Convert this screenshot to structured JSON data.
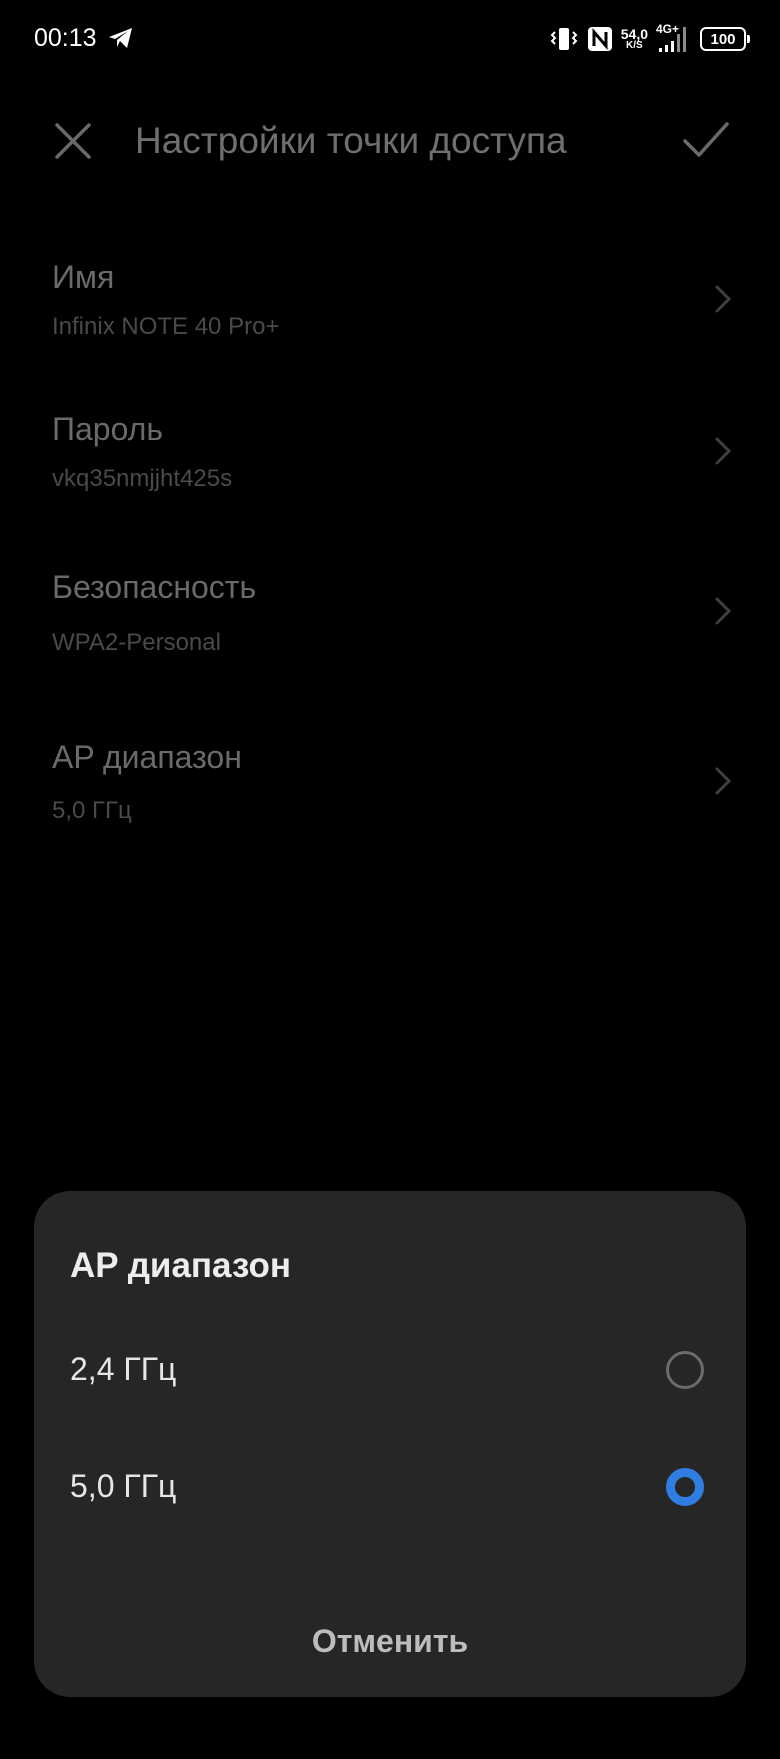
{
  "status_bar": {
    "time": "00:13",
    "net_speed_value": "54,0",
    "net_speed_unit": "K/S",
    "network_type": "4G+",
    "battery": "100",
    "icons": [
      "telegram-icon",
      "vibrate-icon",
      "nfc-icon",
      "signal-icon",
      "battery-icon"
    ]
  },
  "header": {
    "title": "Настройки точки доступа"
  },
  "settings": [
    {
      "title": "Имя",
      "value": "Infinix NOTE 40 Pro+"
    },
    {
      "title": "Пароль",
      "value": "vkq35nmjjht425s"
    },
    {
      "title": "Безопасность",
      "value": "WPA2-Personal"
    },
    {
      "title": "AP диапазон",
      "value": "5,0 ГГц"
    }
  ],
  "sheet": {
    "title": "AP диапазон",
    "options": [
      {
        "label": "2,4 ГГц",
        "selected": false
      },
      {
        "label": "5,0 ГГц",
        "selected": true
      }
    ],
    "cancel_label": "Отменить"
  },
  "colors": {
    "background": "#000000",
    "sheet_background": "#262626",
    "accent": "#2f7de1",
    "dim_text": "#6a6a6a"
  }
}
